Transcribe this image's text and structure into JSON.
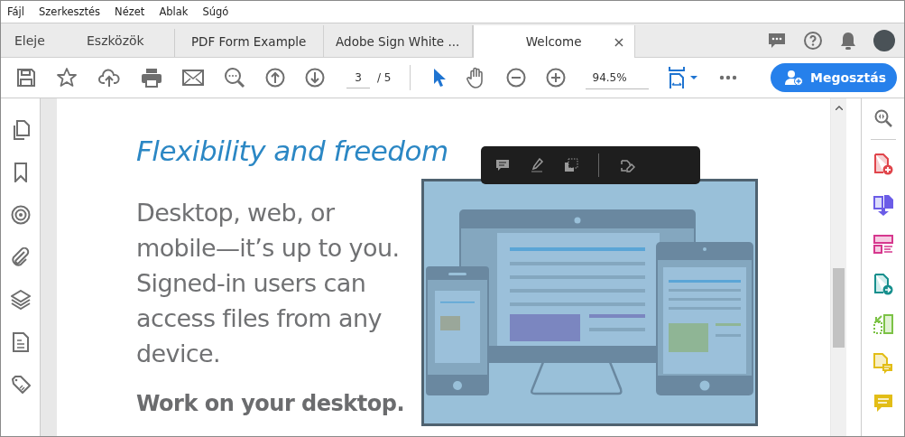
{
  "menu": [
    "Fájl",
    "Szerkesztés",
    "Nézet",
    "Ablak",
    "Súgó"
  ],
  "nav_tabs": [
    {
      "label": "Eleje"
    },
    {
      "label": "Eszközök"
    }
  ],
  "doc_tabs": [
    {
      "label": "PDF Form Example",
      "selected": false
    },
    {
      "label": "Adobe Sign White ...",
      "selected": false
    },
    {
      "label": "Welcome",
      "selected": true,
      "close": "×"
    }
  ],
  "toolbar": {
    "page_current": "3",
    "page_total": "/ 5",
    "zoom": "94.5%",
    "share_button": "Megosztás"
  },
  "document": {
    "heading": "Flexibility and freedom",
    "paragraph": "Desktop, web, or mobile—it’s up to you. Signed-in users can access files from any device.",
    "subheading": "Work on your desktop."
  }
}
